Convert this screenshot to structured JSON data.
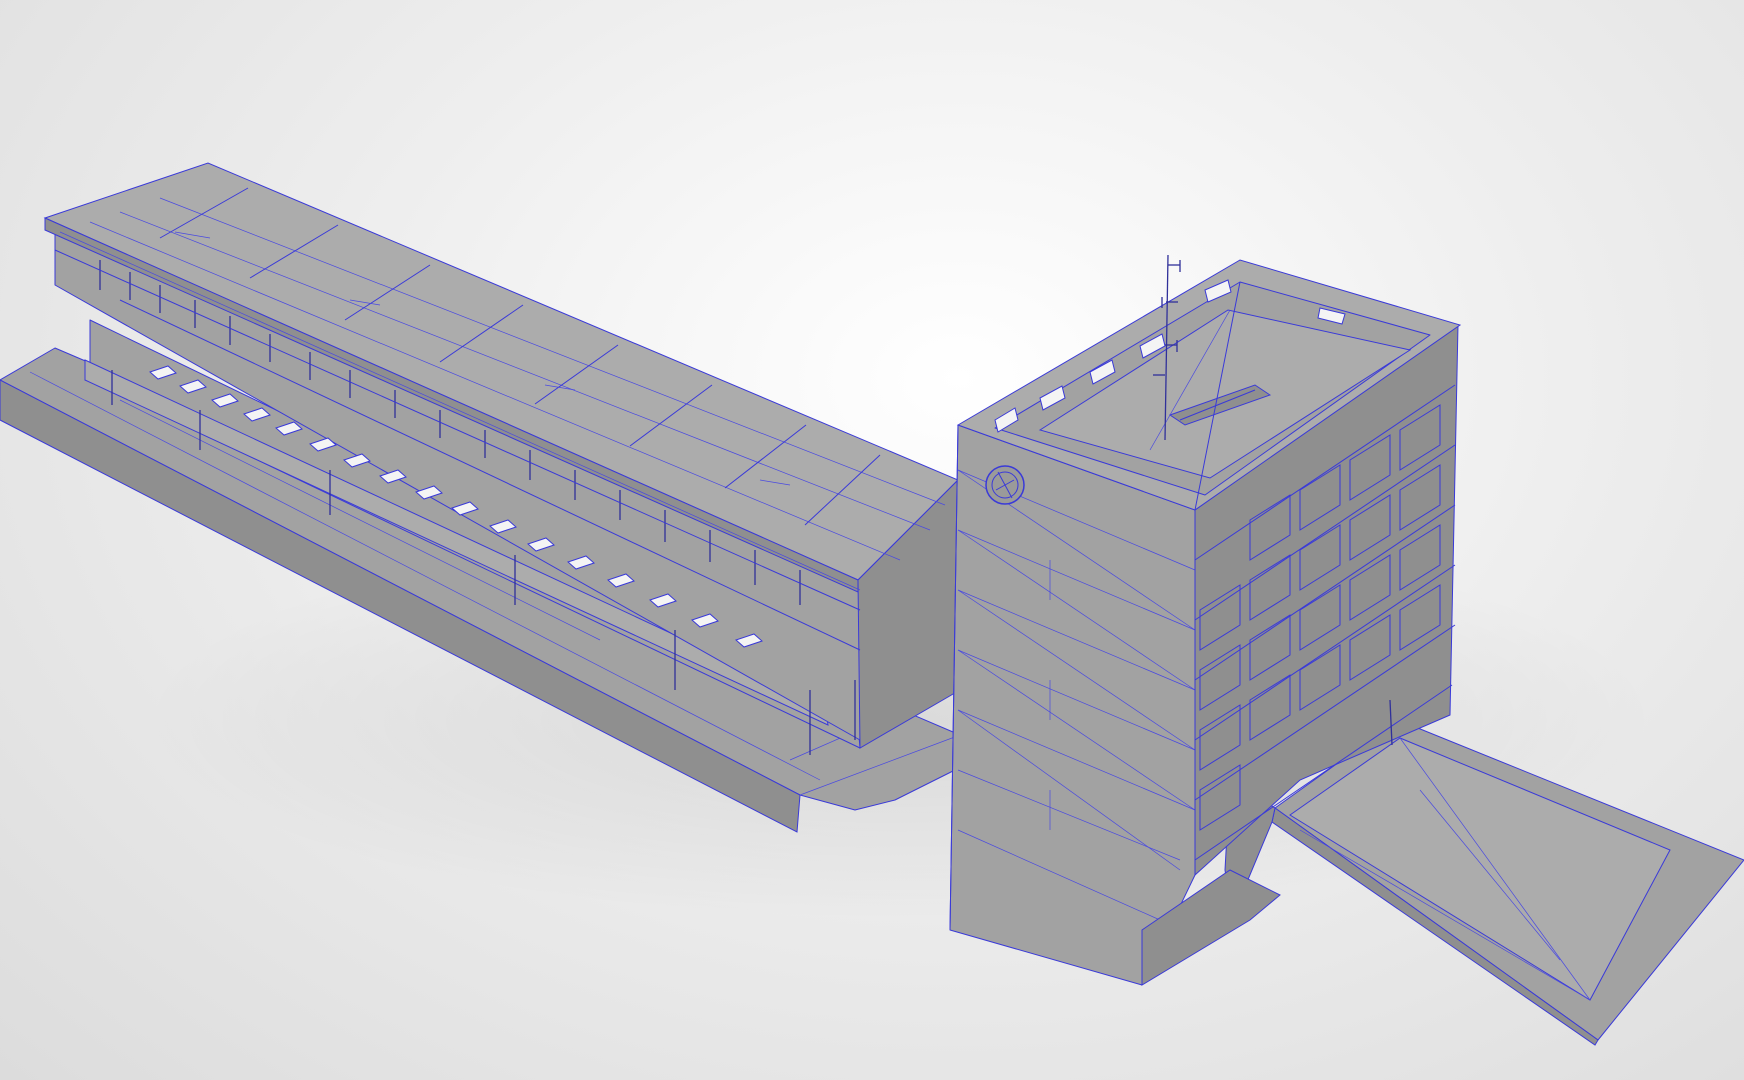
{
  "viewport": {
    "background": "#dcdcdc",
    "mode": "wireframe-shaded"
  },
  "model": {
    "face_color": "#a2a2a2",
    "edge_color": "#3a3ad8",
    "parts": [
      "long-slab-block",
      "tower-block",
      "podium-plinth",
      "entry-ramp",
      "rooftop-antenna",
      "tower-emblem"
    ]
  }
}
